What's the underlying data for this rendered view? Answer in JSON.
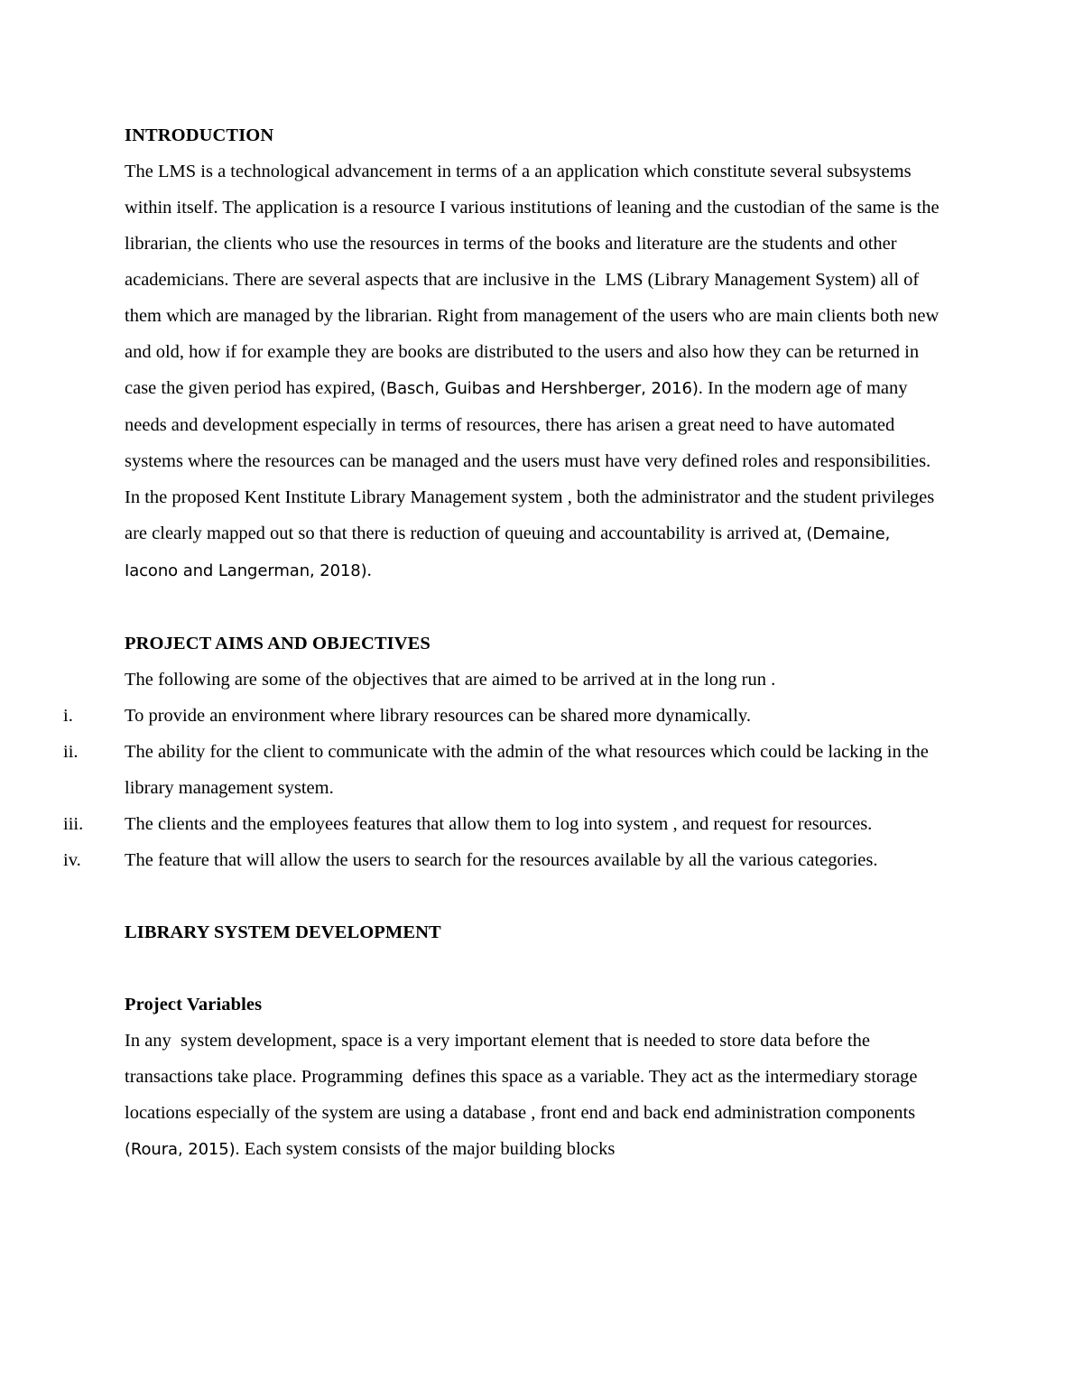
{
  "document": {
    "page_background": "#ffffff",
    "text_color": "#000000",
    "sections": {
      "introduction": {
        "heading": "INTRODUCTION",
        "paragraph_part1": "The LMS is a technological advancement in terms of a an application which constitute several subsystems within itself. The application is a resource I various institutions of leaning and the custodian of the same is the librarian, the clients who use the resources in terms of the books and literature are the students and other academicians. There are several aspects that are inclusive in the  LMS (Library Management System) all of them which are managed by the librarian. Right from management of the users who are main clients both new and old, how if for example they are books are distributed to the users and also how they can be returned in case the given period has expired, ",
        "citation1": "(Basch, Guibas and Hershberger, 2016)",
        "paragraph_part2": ". In the modern age of many needs and development especially in terms of resources, there has arisen a great need to have automated systems where the resources can be managed and the users must have very defined roles and responsibilities. In the proposed Kent Institute Library Management system , both the administrator and the student privileges are clearly mapped out so that there is reduction of queuing and accountability is arrived at, ",
        "citation2": "(Demaine, Iacono and Langerman, 2018)",
        "paragraph_part3": "."
      },
      "project_aims": {
        "heading": "PROJECT AIMS AND OBJECTIVES",
        "lead_in": "The following are some of the objectives that are aimed to be arrived at in the long run .",
        "items": [
          {
            "marker": "i.",
            "text": "To provide an environment where library resources can be shared more dynamically."
          },
          {
            "marker": "ii.",
            "text": "The ability for the client to communicate with the admin of the what resources which could be lacking in the library management system."
          },
          {
            "marker": "iii.",
            "text": "The clients and the employees features that allow them to log into system , and request for resources."
          },
          {
            "marker": "iv.",
            "text": "The feature that will allow the users to search for the resources available by all the various categories."
          }
        ]
      },
      "library_system_development": {
        "heading": "LIBRARY SYSTEM DEVELOPMENT",
        "subheading": "Project Variables",
        "paragraph_part1": "In any  system development, space is a very important element that is needed to store data before the transactions take place. Programming  defines this space as a variable. They act as the intermediary storage locations especially of the system are using a database , front end and back end administration components ",
        "citation3": "(Roura, 2015)",
        "paragraph_part2": ". Each system consists of the major building blocks"
      }
    }
  }
}
